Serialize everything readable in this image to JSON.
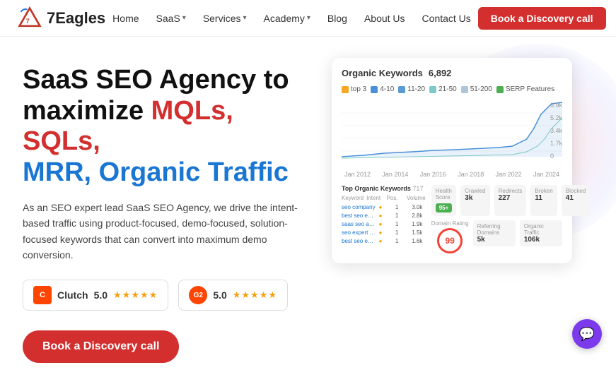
{
  "nav": {
    "logo_text": "7Eagles",
    "links": [
      {
        "label": "Home",
        "has_dropdown": false
      },
      {
        "label": "SaaS",
        "has_dropdown": true
      },
      {
        "label": "Services",
        "has_dropdown": true
      },
      {
        "label": "Academy",
        "has_dropdown": true
      },
      {
        "label": "Blog",
        "has_dropdown": false
      },
      {
        "label": "About Us",
        "has_dropdown": false
      },
      {
        "label": "Contact Us",
        "has_dropdown": false
      }
    ],
    "cta_label": "Book a Discovery call"
  },
  "hero": {
    "headline_line1": "SaaS SEO Agency to",
    "headline_line2_plain": "",
    "headline_colored": "MQLs, SQLs,",
    "headline_blue": "MRR, Organic Traffic",
    "subtext": "As an SEO expert lead SaaS SEO Agency, we drive the intent-based traffic using product-focused, demo-focused, solution-focused keywords that can convert into maximum demo conversion.",
    "cta_label": "Book a Discovery call"
  },
  "badges": [
    {
      "id": "clutch",
      "icon_type": "clutch",
      "label": "Clutch",
      "score": "5.0",
      "stars": "★★★★★"
    },
    {
      "id": "g2",
      "icon_type": "g2",
      "label": "",
      "score": "5.0",
      "stars": "★★★★★"
    }
  ],
  "dashboard": {
    "title": "Organic Keywords",
    "count": "6,892",
    "legend": [
      {
        "label": "top 3",
        "color": "#f5a623"
      },
      {
        "label": "4-10",
        "color": "#4a90d9"
      },
      {
        "label": "11-20",
        "color": "#5b9bd5"
      },
      {
        "label": "21-50",
        "color": "#7ec8c8"
      },
      {
        "label": "51-200",
        "color": "#b0c4d8"
      },
      {
        "label": "SERP Features",
        "color": "#4caf50"
      }
    ],
    "y_labels": [
      "6.9k",
      "5.2k",
      "3.4k",
      "1.7k",
      "0"
    ],
    "x_labels": [
      "Jan 2012",
      "Jan 2014",
      "Jan 2016",
      "Jan 2018",
      "Jan 2022",
      "Jan 2024"
    ],
    "table": {
      "headers": [
        "Keyword",
        "Intent",
        "Pos.",
        "Volume"
      ],
      "rows": [
        [
          "seo company",
          "",
          "1",
          "3.0k"
        ],
        [
          "best seo expert in india",
          "",
          "1",
          "2.8k"
        ],
        [
          "saas seo agency",
          "",
          "1",
          "1.9k"
        ],
        [
          "seo expert india",
          "",
          "1",
          "1.5k"
        ],
        [
          "best seo expert in india",
          "",
          "1",
          "1.6k"
        ]
      ],
      "count": "717"
    },
    "stats": {
      "health_score": "95+",
      "health_label": "Health Score",
      "crawled": "3k",
      "crawled_label": "Crawled",
      "redirects": "227",
      "redirects_label": "Redirects",
      "broken": "11",
      "broken_label": "Broken",
      "blocked": "41",
      "blocked_label": "Blocked",
      "domain_rating": "99",
      "domain_rating_label": "Domain Rating",
      "referring_domains": "5k",
      "referring_domains_label": "Referring Domains",
      "organic_traffic": "106k",
      "organic_traffic_label": "Organic Traffic"
    }
  },
  "chat": {
    "icon": "💬"
  }
}
